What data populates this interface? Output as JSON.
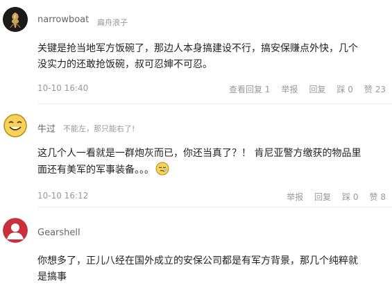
{
  "comments": [
    {
      "username": "narrowboat",
      "tagline": "扁舟浪子",
      "lines": [
        "关键是抢当地军方饭碗了，那边人本身搞建设不行，搞安保赚点外快，几个",
        "没实力的还敢抢饭碗，叔可忍婶不可忍。"
      ],
      "timestamp": "10-10 16:40",
      "actions": {
        "view_replies": "查看回复 1",
        "report": "举报",
        "reply": "回复",
        "downvote": "踩 0",
        "upvote": "赞 23"
      }
    },
    {
      "username": "牛过",
      "tagline": "不能左，那只能右了!",
      "lines": [
        "这几个人一看就是一群炮灰而已，你还当真了？！ 肯尼亚警方缴获的物品里",
        "面还有美军的军事装备。。。"
      ],
      "timestamp": "10-10 16:12",
      "actions": {
        "report": "举报",
        "reply": "回复",
        "downvote": "踩 0",
        "upvote": "赞 8"
      }
    },
    {
      "username": "Gearshell",
      "lines": [
        "你想多了，正儿八经在国外成立的安保公司都是有军方背景，那几个纯粹就",
        "是搞事"
      ]
    }
  ],
  "colors": {
    "avatar3_bg": "#c9303e",
    "divider": "#eeeeee",
    "muted": "#999999"
  },
  "icons": {
    "avatar1": "gold-rose-avatar",
    "avatar2": "smiley-emoji-avatar",
    "avatar3": "default-user-avatar",
    "inline_emoji": "sleepy-smiley-emoji"
  }
}
